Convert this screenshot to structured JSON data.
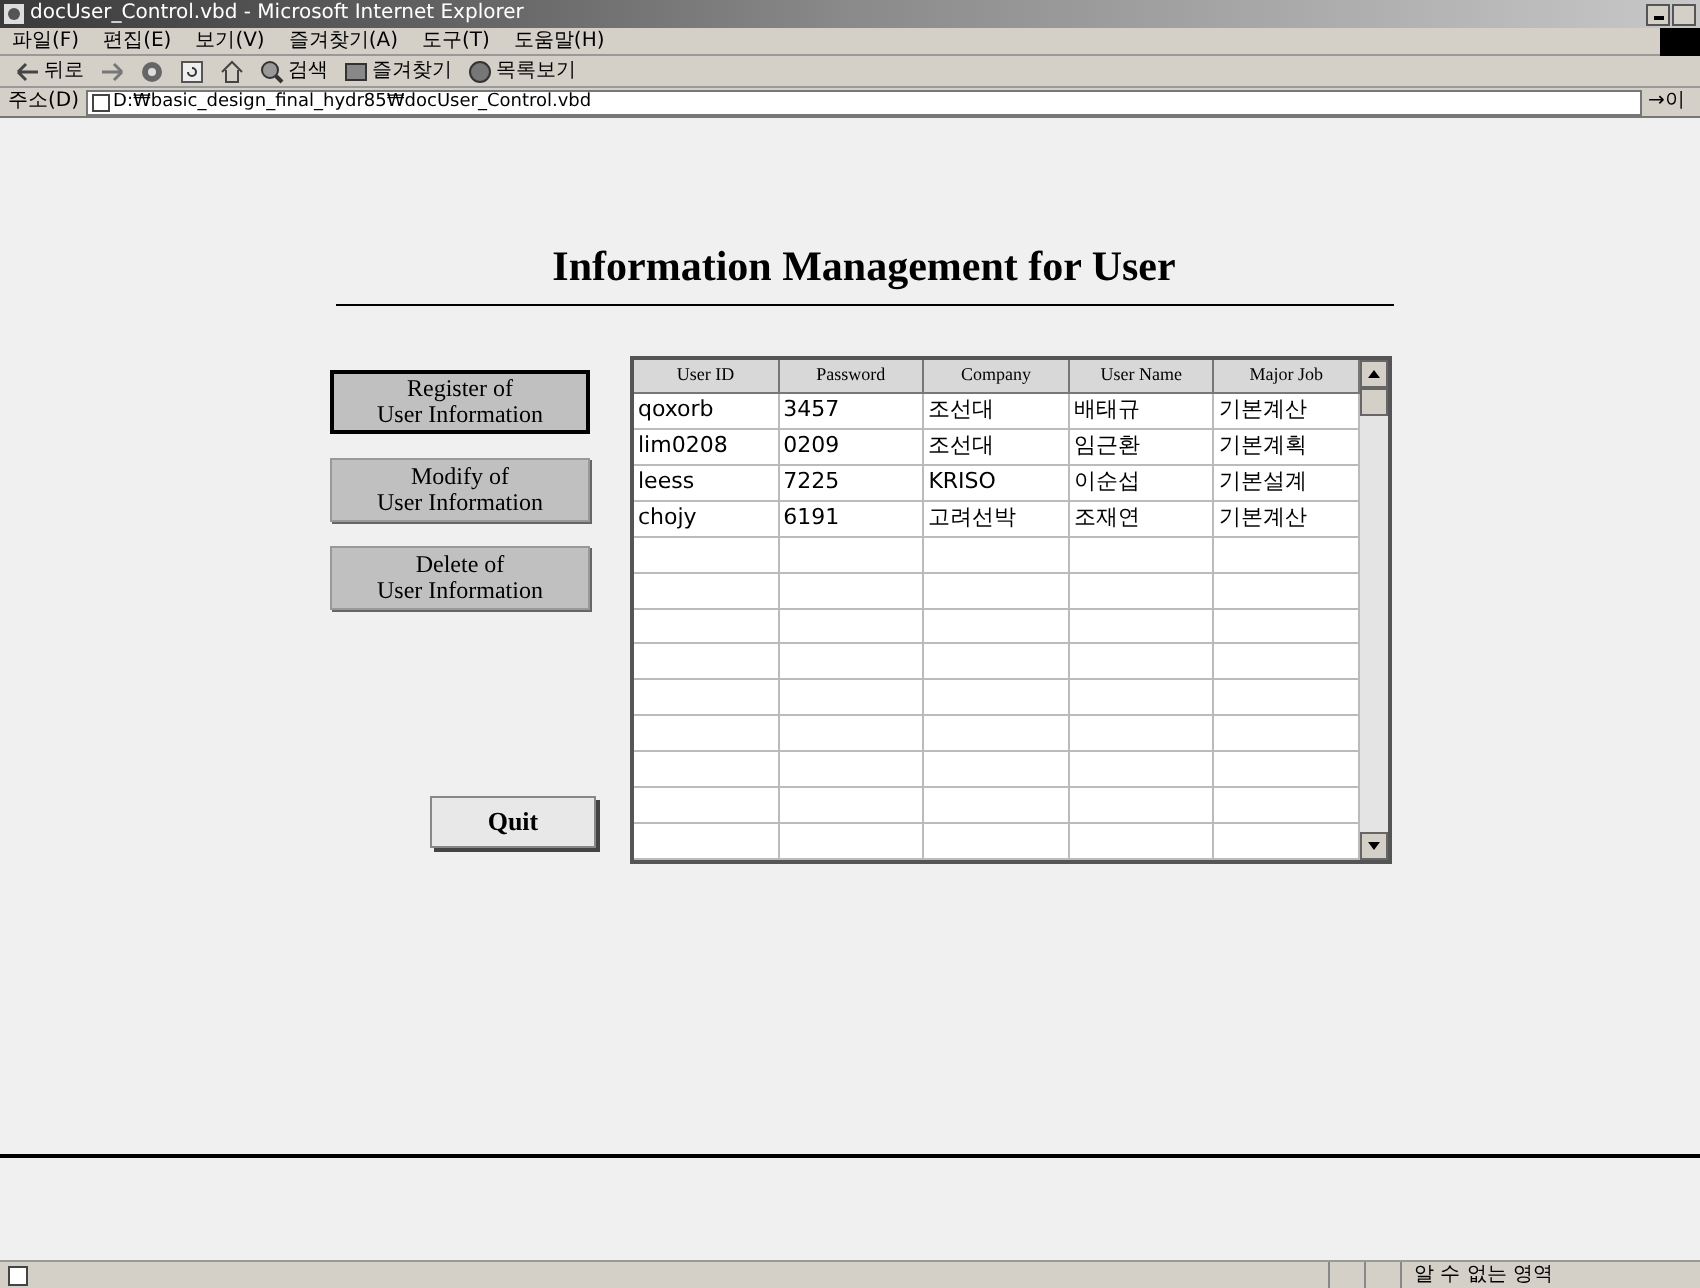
{
  "window": {
    "title": "docUser_Control.vbd - Microsoft Internet Explorer"
  },
  "menu": [
    "파일(F)",
    "편집(E)",
    "보기(V)",
    "즐겨찾기(A)",
    "도구(T)",
    "도움말(H)"
  ],
  "toolbar": [
    {
      "kind": "arrow",
      "label": "뒤로"
    },
    {
      "kind": "forward"
    },
    {
      "kind": "stop"
    },
    {
      "kind": "refresh"
    },
    {
      "kind": "home"
    },
    {
      "kind": "search",
      "label": "검색"
    },
    {
      "kind": "favorites",
      "label": "즐겨찾기"
    },
    {
      "kind": "history",
      "label": "목록보기"
    }
  ],
  "address": {
    "label": "주소(D)",
    "value": "D:₩basic_design_final_hydr85₩docUser_Control.vbd",
    "go": "→이"
  },
  "page": {
    "title": "Information Management for User",
    "buttons": [
      {
        "line1": "Register of",
        "line2": "User Information",
        "focused": true
      },
      {
        "line1": "Modify of",
        "line2": "User Information",
        "focused": false
      },
      {
        "line1": "Delete of",
        "line2": "User Information",
        "focused": false
      }
    ],
    "quit": "Quit",
    "table": {
      "columns": [
        "User ID",
        "Password",
        "Company",
        "User Name",
        "Major Job"
      ],
      "rows": [
        [
          "qoxorb",
          "3457",
          "조선대",
          "배태규",
          "기본계산"
        ],
        [
          "lim0208",
          "0209",
          "조선대",
          "임근환",
          "기본계획"
        ],
        [
          "leess",
          "7225",
          "KRISO",
          "이순섭",
          "기본설계"
        ],
        [
          "chojy",
          "6191",
          "고려선박",
          "조재연",
          "기본계산"
        ]
      ]
    }
  },
  "status_bar": {
    "zone": "알 수 없는 영역"
  }
}
